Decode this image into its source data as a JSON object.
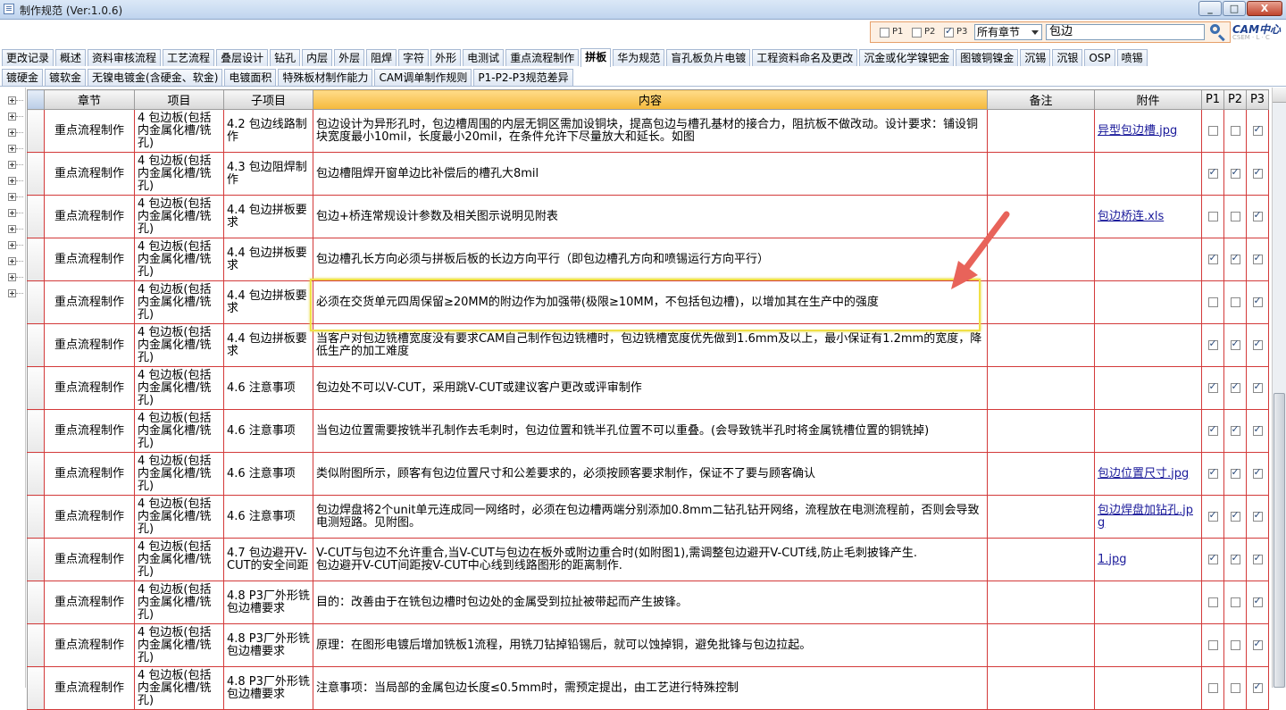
{
  "window": {
    "title": "制作规范 (Ver:1.0.6)",
    "minimize_glyph": "_",
    "maximize_glyph": "□",
    "close_glyph": "X"
  },
  "search": {
    "p1_label": "P1",
    "p2_label": "P2",
    "p3_label": "P3",
    "p1_checked": false,
    "p2_checked": false,
    "p3_checked": true,
    "chapter_selected": "所有章节",
    "query": "包边"
  },
  "logo": {
    "text": "CAM中心",
    "sub": "CSEM · L · C"
  },
  "tabs_row1": [
    "更改记录",
    "概述",
    "资料审核流程",
    "工艺流程",
    "叠层设计",
    "钻孔",
    "内层",
    "外层",
    "阻焊",
    "字符",
    "外形",
    "电测试",
    "重点流程制作",
    "拼板",
    "华为规范",
    "盲孔板负片电镀",
    "工程资料命名及更改",
    "沉金或化学镍钯金",
    "图镀铜镍金",
    "沉锡",
    "沉银",
    "OSP",
    "喷锡"
  ],
  "tabs_row2": [
    "镀硬金",
    "镀软金",
    "无镍电镀金(含硬金、软金)",
    "电镀面积",
    "特殊板材制作能力",
    "CAM调单制作规则",
    "P1-P2-P3规范差异"
  ],
  "active_tab": "拼板",
  "columns": [
    "章节",
    "项目",
    "子项目",
    "内容",
    "备注",
    "附件",
    "P1",
    "P2",
    "P3"
  ],
  "rows": [
    {
      "chapter": "重点流程制作",
      "item": "4 包边板(包括内金属化槽/铣孔)",
      "sub": "4.2 包边线路制作",
      "content": "包边设计为异形孔时，包边槽周围的内层无铜区需加设铜块，提高包边与槽孔基材的接合力，阻抗板不做改动。设计要求：铺设铜块宽度最小10mil，长度最小20mil，在条件允许下尽量放大和延长。如图",
      "note": "",
      "attach": "异型包边槽.jpg",
      "p1": false,
      "p2": false,
      "p3": true
    },
    {
      "chapter": "重点流程制作",
      "item": "4 包边板(包括内金属化槽/铣孔)",
      "sub": "4.3 包边阻焊制作",
      "content": "包边槽阻焊开窗单边比补偿后的槽孔大8mil",
      "note": "",
      "attach": "",
      "p1": true,
      "p2": true,
      "p3": true
    },
    {
      "chapter": "重点流程制作",
      "item": "4 包边板(包括内金属化槽/铣孔)",
      "sub": "4.4 包边拼板要求",
      "content": "包边+桥连常规设计参数及相关图示说明见附表",
      "note": "",
      "attach": "包边桥连.xls",
      "p1": false,
      "p2": false,
      "p3": true
    },
    {
      "chapter": "重点流程制作",
      "item": "4 包边板(包括内金属化槽/铣孔)",
      "sub": "4.4 包边拼板要求",
      "content": "包边槽孔长方向必须与拼板后板的长边方向平行（即包边槽孔方向和喷锡运行方向平行）",
      "note": "",
      "attach": "",
      "p1": true,
      "p2": true,
      "p3": true
    },
    {
      "chapter": "重点流程制作",
      "item": "4 包边板(包括内金属化槽/铣孔)",
      "sub": "4.4 包边拼板要求",
      "content": "必须在交货单元四周保留≥20MM的附边作为加强带(极限≥10MM，不包括包边槽)，以增加其在生产中的强度",
      "note": "",
      "attach": "",
      "p1": false,
      "p2": false,
      "p3": true
    },
    {
      "chapter": "重点流程制作",
      "item": "4 包边板(包括内金属化槽/铣孔)",
      "sub": "4.4 包边拼板要求",
      "content": "当客户对包边铣槽宽度没有要求CAM自己制作包边铣槽时，包边铣槽宽度优先做到1.6mm及以上，最小保证有1.2mm的宽度，降低生产的加工难度",
      "note": "",
      "attach": "",
      "p1": true,
      "p2": true,
      "p3": true
    },
    {
      "chapter": "重点流程制作",
      "item": "4 包边板(包括内金属化槽/铣孔)",
      "sub": "4.6 注意事项",
      "content": "包边处不可以V-CUT，采用跳V-CUT或建议客户更改或评审制作",
      "note": "",
      "attach": "",
      "p1": true,
      "p2": true,
      "p3": true
    },
    {
      "chapter": "重点流程制作",
      "item": "4 包边板(包括内金属化槽/铣孔)",
      "sub": "4.6 注意事项",
      "content": "当包边位置需要按铣半孔制作去毛刺时，包边位置和铣半孔位置不可以重叠。(会导致铣半孔时将金属铣槽位置的铜铣掉)",
      "note": "",
      "attach": "",
      "p1": true,
      "p2": true,
      "p3": true
    },
    {
      "chapter": "重点流程制作",
      "item": "4 包边板(包括内金属化槽/铣孔)",
      "sub": "4.6 注意事项",
      "content": "类似附图所示，顾客有包边位置尺寸和公差要求的，必须按顾客要求制作，保证不了要与顾客确认",
      "note": "",
      "attach": "包边位置尺寸.jpg",
      "p1": true,
      "p2": true,
      "p3": true
    },
    {
      "chapter": "重点流程制作",
      "item": "4 包边板(包括内金属化槽/铣孔)",
      "sub": "4.6 注意事项",
      "content": "包边焊盘将2个unit单元连成同一网络时，必须在包边槽两端分别添加0.8mm二钻孔钻开网络，流程放在电测流程前，否则会导致电测短路。见附图。",
      "note": "",
      "attach": "包边焊盘加钻孔.jpg",
      "p1": true,
      "p2": true,
      "p3": true
    },
    {
      "chapter": "重点流程制作",
      "item": "4 包边板(包括内金属化槽/铣孔)",
      "sub": "4.7 包边避开V-CUT的安全间距",
      "content": "V-CUT与包边不允许重合,当V-CUT与包边在板外或附边重合时(如附图1),需调整包边避开V-CUT线,防止毛刺披锋产生.\n包边避开V-CUT间距按V-CUT中心线到线路图形的距离制作.",
      "note": "",
      "attach": "1.jpg",
      "p1": true,
      "p2": true,
      "p3": true
    },
    {
      "chapter": "重点流程制作",
      "item": "4 包边板(包括内金属化槽/铣孔)",
      "sub": "4.8 P3厂外形铣包边槽要求",
      "content": "目的：改善由于在铣包边槽时包边处的金属受到拉扯被带起而产生披锋。",
      "note": "",
      "attach": "",
      "p1": false,
      "p2": false,
      "p3": true
    },
    {
      "chapter": "重点流程制作",
      "item": "4 包边板(包括内金属化槽/铣孔)",
      "sub": "4.8 P3厂外形铣包边槽要求",
      "content": "原理：在图形电镀后增加铣板1流程，用铣刀钻掉铅锡后，就可以蚀掉铜，避免批锋与包边拉起。",
      "note": "",
      "attach": "",
      "p1": false,
      "p2": false,
      "p3": true
    },
    {
      "chapter": "重点流程制作",
      "item": "4 包边板(包括内金属化槽/铣孔)",
      "sub": "4.8 P3厂外形铣包边槽要求",
      "content": "注意事项：当局部的金属包边长度≤0.5mm时，需预定提出，由工艺进行特殊控制",
      "note": "",
      "attach": "",
      "p1": false,
      "p2": false,
      "p3": true
    }
  ]
}
